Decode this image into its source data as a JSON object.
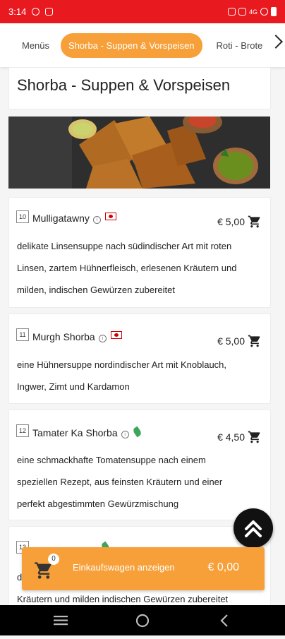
{
  "status_bar": {
    "time": "3:14",
    "indicators": "4G",
    "icons": [
      "notification-icon",
      "sync-icon",
      "hd-icon",
      "signal-icon",
      "wifi-icon",
      "battery-icon"
    ]
  },
  "tabs": [
    {
      "label": "Menüs",
      "active": false
    },
    {
      "label": "Shorba - Suppen & Vorspeisen",
      "active": true
    },
    {
      "label": "Roti - Brote",
      "active": false
    }
  ],
  "section": {
    "title": "Shorba - Suppen & Vorspeisen"
  },
  "items": [
    {
      "number": "10",
      "name": "Mulligatawny",
      "badge": "chicken-flag",
      "price": "€ 5,00",
      "description_lines": [
        "delikate Linsensuppe nach südindischer Art mit roten",
        "Linsen, zartem Hühnerfleisch, erlesenen Kräutern und",
        "milden, indischen Gewürzen zubereitet"
      ]
    },
    {
      "number": "11",
      "name": "Murgh Shorba",
      "badge": "chicken-flag",
      "price": "€ 5,00",
      "description_lines": [
        "eine Hühnersuppe nordindischer Art mit Knoblauch,",
        "Ingwer, Zimt und Kardamon"
      ]
    },
    {
      "number": "12",
      "name": "Tamater Ka Shorba",
      "badge": "vegetarian-leaf",
      "price": "€ 4,50",
      "description_lines": [
        "eine schmackhafte Tomatensuppe nach einem",
        "speziellen Rezept, aus feinsten Kräutern und einer",
        "perfekt abgestimmten Gewürzmischung"
      ]
    },
    {
      "number": "13",
      "partial_description_line": "Kräutern und milden indischen Gewürzen zubereitet",
      "partial_description_start": "d"
    }
  ],
  "cart": {
    "count": "0",
    "label": "Einkaufswagen anzeigen",
    "total": "€ 0,00"
  },
  "colors": {
    "status_bar": "#e8191f",
    "accent": "#f7a03a",
    "fab": "#111111",
    "nav_bar": "#000000"
  }
}
